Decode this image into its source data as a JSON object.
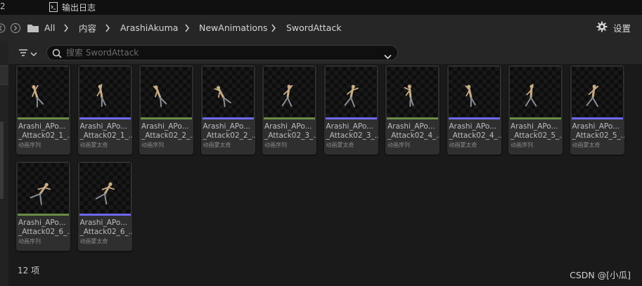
{
  "top_tab": {
    "left_number": "2",
    "label": "输出日志",
    "icon": "output-log-icon"
  },
  "path": {
    "back_icon": "back-arrow-icon",
    "forward_icon": "forward-arrow-icon",
    "folder_icon": "folder-icon",
    "chevron_icon": "chevron-right-icon",
    "breadcrumbs": [
      "All",
      "内容",
      "ArashiAkuma",
      "NewAnimations",
      "SwordAttack"
    ]
  },
  "settings": {
    "label": "设置",
    "icon": "gear-icon"
  },
  "filter": {
    "icon": "filter-icon"
  },
  "search": {
    "placeholder": "搜索 SwordAttack",
    "value": "",
    "icon": "search-icon",
    "dropdown_icon": "chevron-down-icon"
  },
  "assets": [
    {
      "line1": "Arashi_APo...",
      "line2": "_Attack02_1_...",
      "type": "动画序列",
      "bar_color": "#6a8c46",
      "pose": "figure-pose-1"
    },
    {
      "line1": "Arashi_APo...",
      "line2": "_Attack02_1_...",
      "type": "动画蒙太奇",
      "bar_color": "#6f67ee",
      "pose": "figure-pose-2"
    },
    {
      "line1": "Arashi_APo...",
      "line2": "_Attack02_2_...",
      "type": "动画序列",
      "bar_color": "#6a8c46",
      "pose": "figure-pose-3"
    },
    {
      "line1": "Arashi_APo...",
      "line2": "_Attack02_2_...",
      "type": "动画蒙太奇",
      "bar_color": "#6f67ee",
      "pose": "figure-pose-4"
    },
    {
      "line1": "Arashi_APo...",
      "line2": "_Attack02_3_...",
      "type": "动画序列",
      "bar_color": "#6a8c46",
      "pose": "figure-pose-5"
    },
    {
      "line1": "Arashi_APo...",
      "line2": "_Attack02_3_...",
      "type": "动画蒙太奇",
      "bar_color": "#6f67ee",
      "pose": "figure-pose-6"
    },
    {
      "line1": "Arashi_APo...",
      "line2": "_Attack02_4_...",
      "type": "动画序列",
      "bar_color": "#6a8c46",
      "pose": "figure-pose-7"
    },
    {
      "line1": "Arashi_APo...",
      "line2": "_Attack02_4_...",
      "type": "动画蒙太奇",
      "bar_color": "#6f67ee",
      "pose": "figure-pose-8"
    },
    {
      "line1": "Arashi_APo...",
      "line2": "_Attack02_5_...",
      "type": "动画序列",
      "bar_color": "#6a8c46",
      "pose": "figure-pose-9"
    },
    {
      "line1": "Arashi_APo...",
      "line2": "_Attack02_5_...",
      "type": "动画蒙太奇",
      "bar_color": "#6f67ee",
      "pose": "figure-pose-10"
    },
    {
      "line1": "Arashi_APo...",
      "line2": "_Attack02_6_...",
      "type": "动画序列",
      "bar_color": "#6a8c46",
      "pose": "figure-pose-11"
    },
    {
      "line1": "Arashi_APo...",
      "line2": "_Attack02_6_...",
      "type": "动画蒙太奇",
      "bar_color": "#6f67ee",
      "pose": "figure-pose-12"
    }
  ],
  "footer": {
    "count": "12 项"
  },
  "watermark": "CSDN @[小瓜]"
}
